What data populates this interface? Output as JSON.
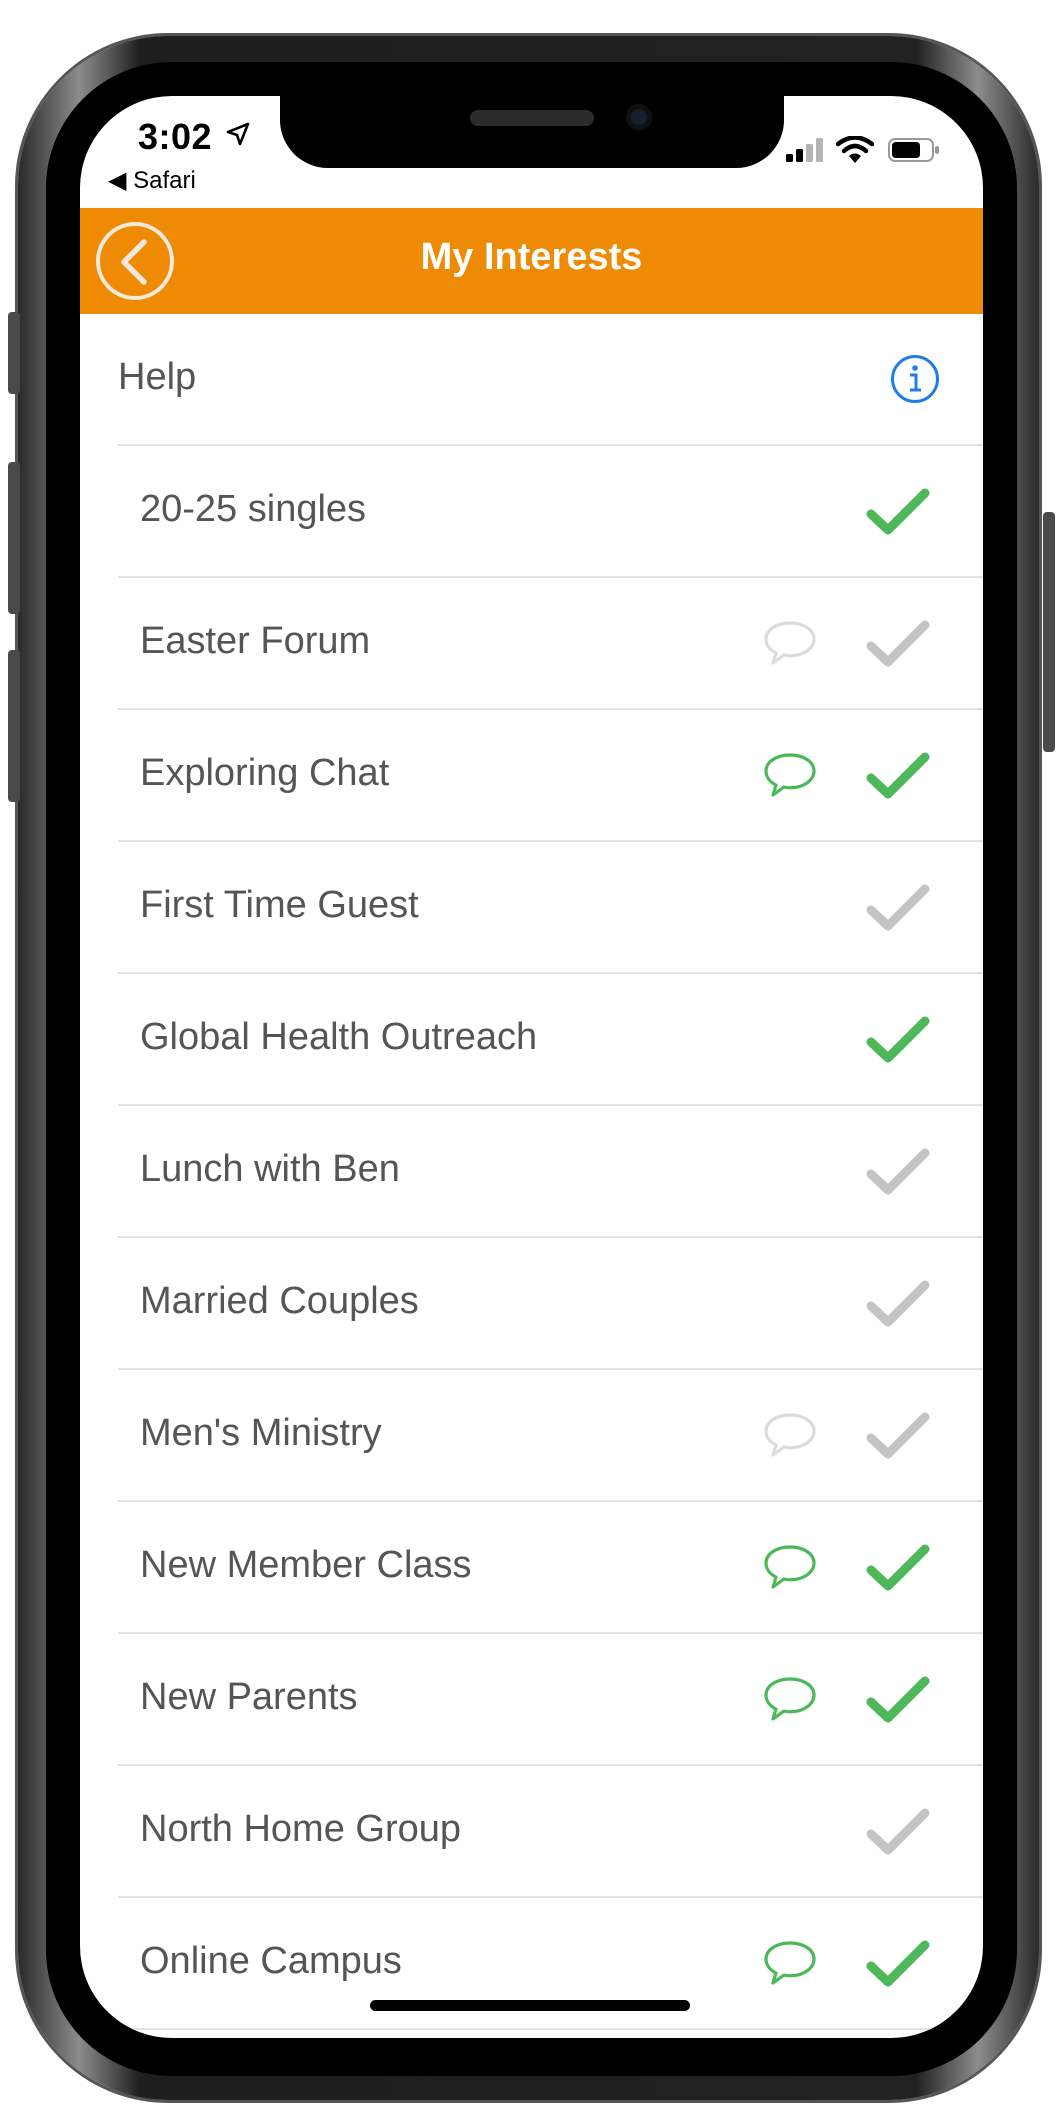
{
  "status_bar": {
    "time": "3:02",
    "back_app": "◀ Safari"
  },
  "navbar": {
    "title": "My Interests",
    "back_icon": "chevron-left-circle-icon",
    "color": "#ef8a05"
  },
  "help": {
    "label": "Help",
    "icon": "info-icon"
  },
  "colors": {
    "active_green": "#4cb859",
    "inactive_gray": "#c4c4c4",
    "text": "#555555"
  },
  "interests": [
    {
      "label": "20-25 singles",
      "chat": "none",
      "checked": true
    },
    {
      "label": "Easter Forum",
      "chat": "inactive",
      "checked": false
    },
    {
      "label": "Exploring Chat",
      "chat": "active",
      "checked": true
    },
    {
      "label": "First Time Guest",
      "chat": "none",
      "checked": false
    },
    {
      "label": "Global Health Outreach",
      "chat": "none",
      "checked": true
    },
    {
      "label": "Lunch with Ben",
      "chat": "none",
      "checked": false
    },
    {
      "label": "Married Couples",
      "chat": "none",
      "checked": false
    },
    {
      "label": "Men's Ministry",
      "chat": "inactive",
      "checked": false
    },
    {
      "label": "New Member Class",
      "chat": "active",
      "checked": true
    },
    {
      "label": "New Parents",
      "chat": "active",
      "checked": true
    },
    {
      "label": "North Home Group",
      "chat": "none",
      "checked": false
    },
    {
      "label": "Online Campus",
      "chat": "active",
      "checked": true
    }
  ]
}
